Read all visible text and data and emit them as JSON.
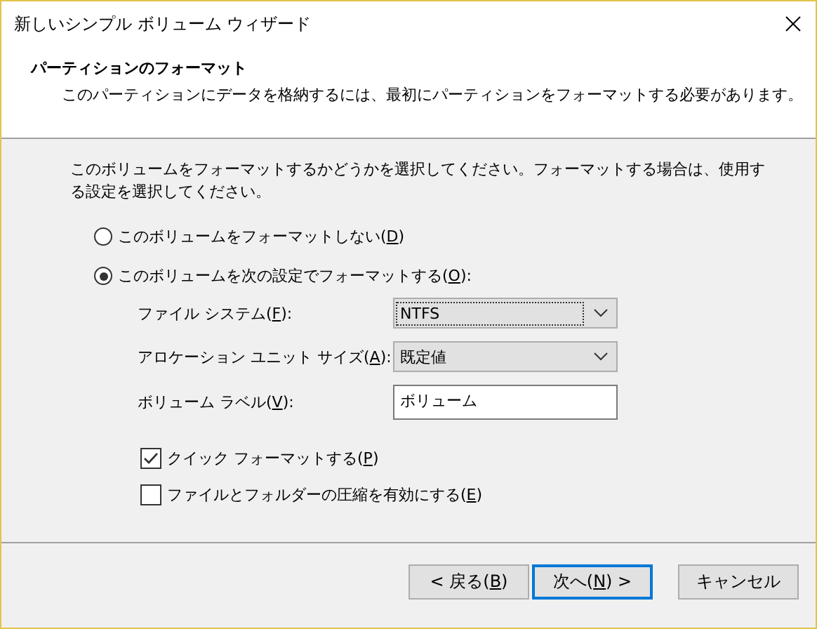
{
  "window": {
    "title": "新しいシンプル ボリューム ウィザード"
  },
  "header": {
    "title": "パーティションのフォーマット",
    "subtitle": "このパーティションにデータを格納するには、最初にパーティションをフォーマットする必要があります。"
  },
  "instruction": "このボリュームをフォーマットするかどうかを選択してください。フォーマットする場合は、使用する設定を選択してください。",
  "options": [
    {
      "before": "このボリュームをフォーマットしない(",
      "key": "D",
      "after": ")",
      "selected": false
    },
    {
      "before": "このボリュームを次の設定でフォーマットする(",
      "key": "O",
      "after": "):",
      "selected": true
    }
  ],
  "fields": [
    {
      "kind": "dropdown",
      "before": "ファイル システム(",
      "key": "F",
      "after": "):",
      "value": "NTFS",
      "focused": true
    },
    {
      "kind": "dropdown",
      "before": "アロケーション ユニット サイズ(",
      "key": "A",
      "after": "):",
      "value": "既定値",
      "focused": false
    },
    {
      "kind": "text",
      "before": "ボリューム ラベル(",
      "key": "V",
      "after": "):",
      "value": "ボリューム"
    }
  ],
  "checkboxes": [
    {
      "before": "クイック フォーマットする(",
      "key": "P",
      "after": ")",
      "checked": true
    },
    {
      "before": "ファイルとフォルダーの圧縮を有効にする(",
      "key": "E",
      "after": ")",
      "checked": false
    }
  ],
  "buttons": [
    {
      "before": "< 戻る(",
      "key": "B",
      "after": ")",
      "default": false
    },
    {
      "before": "次へ(",
      "key": "N",
      "after": ") >",
      "default": true
    },
    {
      "before": "キャンセル",
      "default": false
    }
  ]
}
